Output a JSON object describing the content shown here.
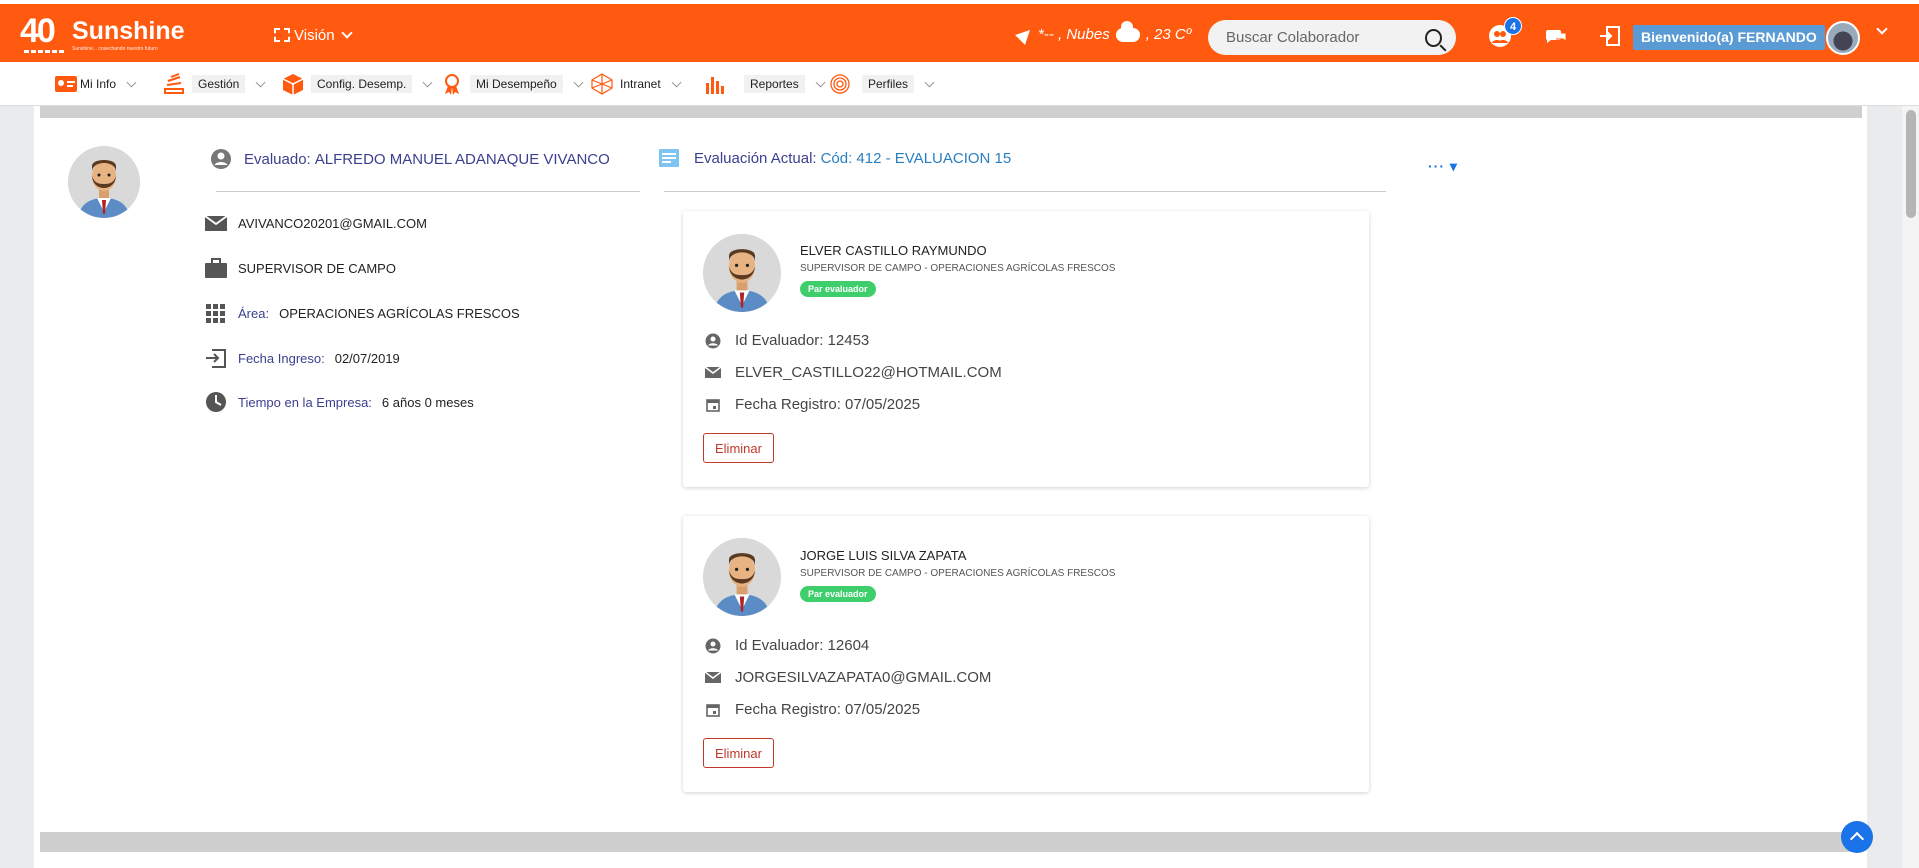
{
  "header": {
    "logo_number": "40",
    "logo_name": "Sunshine",
    "logo_tagline": "Sunshine... cosechando nuestro futuro",
    "vision_label": "Visión",
    "weather_text": "*-- , Nubes",
    "temperature": ", 23 Cº",
    "search_placeholder": "Buscar Colaborador",
    "notification_count": "4",
    "welcome": "Bienvenido(a) FERNANDO",
    "accent_color": "#ff5a0f"
  },
  "menu": [
    {
      "label": "Mi Info",
      "icon": "id-card-icon"
    },
    {
      "label": "Gestión",
      "icon": "stack-icon"
    },
    {
      "label": "Config. Desemp.",
      "icon": "box-icon"
    },
    {
      "label": "Mi Desempeño",
      "icon": "award-icon"
    },
    {
      "label": "Intranet",
      "icon": "network-icon"
    },
    {
      "label": "Reportes",
      "icon": "bar-chart-icon"
    },
    {
      "label": "Perfiles",
      "icon": "fingerprint-icon"
    }
  ],
  "evaluado": {
    "label": "Evaluado:",
    "name": "ALFREDO MANUEL ADANAQUE VIVANCO",
    "email": "AVIVANCO20201@GMAIL.COM",
    "position": "SUPERVISOR DE CAMPO",
    "area_label": "Área:",
    "area": "OPERACIONES AGRÍCOLAS FRESCOS",
    "ingreso_label": "Fecha Ingreso:",
    "ingreso": "02/07/2019",
    "tiempo_label": "Tiempo en la Empresa:",
    "tiempo": "6 años 0 meses"
  },
  "evaluacion": {
    "label": "Evaluación Actual:",
    "code": "Cód: 412 - EVALUACION 15"
  },
  "evaluators": [
    {
      "name": "ELVER CASTILLO RAYMUNDO",
      "subtitle": "SUPERVISOR DE CAMPO - OPERACIONES AGRÍCOLAS FRESCOS",
      "tag": "Par evaluador",
      "id_line": "Id Evaluador: 12453",
      "email": "ELVER_CASTILLO22@HOTMAIL.COM",
      "date_line": "Fecha Registro: 07/05/2025",
      "delete_label": "Eliminar"
    },
    {
      "name": "JORGE LUIS SILVA ZAPATA",
      "subtitle": "SUPERVISOR DE CAMPO - OPERACIONES AGRÍCOLAS FRESCOS",
      "tag": "Par evaluador",
      "id_line": "Id Evaluador: 12604",
      "email": "JORGESILVAZAPATA0@GMAIL.COM",
      "date_line": "Fecha Registro: 07/05/2025",
      "delete_label": "Eliminar"
    }
  ]
}
